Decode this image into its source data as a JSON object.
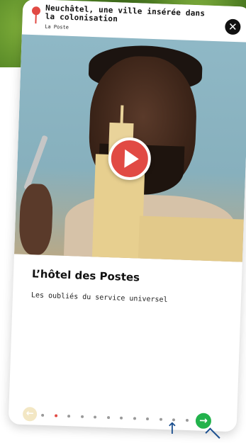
{
  "header": {
    "title": "Neuchâtel, une ville insérée dans la colonisation",
    "subtitle": "La Poste",
    "close_icon": "close-icon"
  },
  "video": {
    "play_icon": "play-icon"
  },
  "content": {
    "title": "L’hôtel des Postes",
    "subtitle": "Les oubliés du service universel"
  },
  "pagination": {
    "prev_icon": "arrow-left-icon",
    "next_icon": "arrow-right-icon",
    "total_dots": 12,
    "active_index": 1
  },
  "colors": {
    "accent_red": "#e14a44",
    "next_green": "#22b24c",
    "pointer_blue": "#1b4f8f"
  }
}
